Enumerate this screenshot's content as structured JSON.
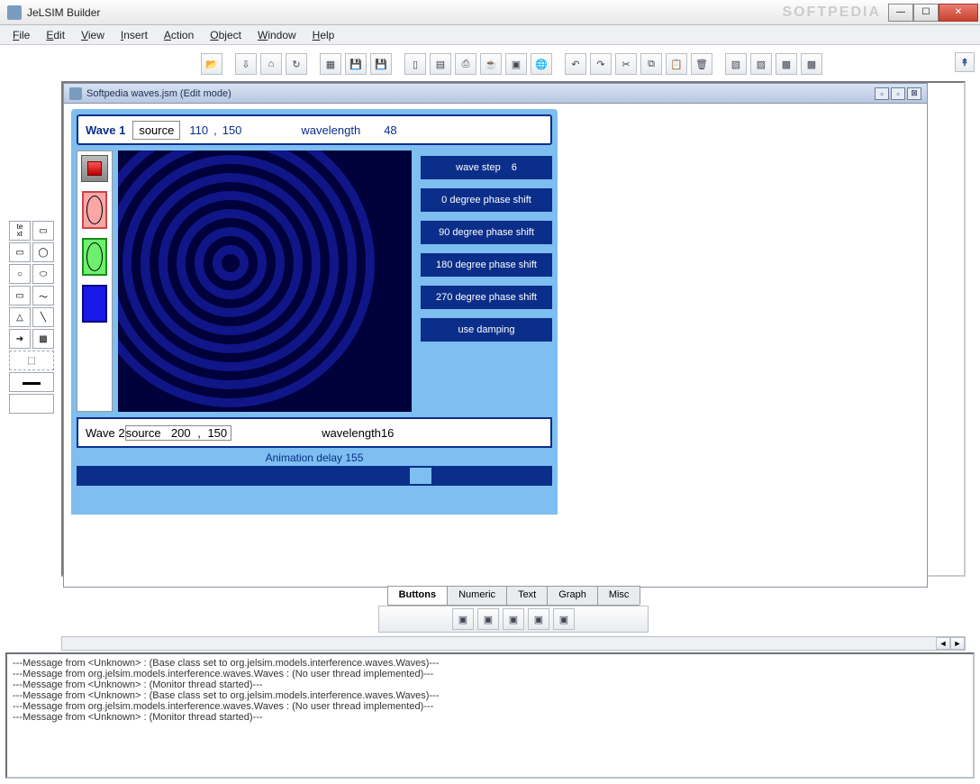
{
  "window": {
    "title": "JeLSIM Builder",
    "watermark": "SOFTPEDIA"
  },
  "menu": [
    "File",
    "Edit",
    "View",
    "Insert",
    "Action",
    "Object",
    "Window",
    "Help"
  ],
  "internal_frame": {
    "title": "Softpedia waves.jsm (Edit mode)"
  },
  "wave1": {
    "label": "Wave 1",
    "source_label": "source",
    "x": "110",
    "y": "150",
    "wl_label": "wavelength",
    "wl": "48"
  },
  "wave2": {
    "label": "Wave 2",
    "source_label": "source",
    "x": "200",
    "y": "150",
    "wl_label": "wavelength",
    "wl": "16"
  },
  "controls": {
    "wavestep_label": "wave step",
    "wavestep": "6",
    "ps0": "0 degree phase shift",
    "ps90": "90 degree phase shift",
    "ps180": "180 degree phase shift",
    "ps270": "270 degree phase shift",
    "damping": "use damping"
  },
  "slider": {
    "label": "Animation delay",
    "value": "155"
  },
  "tabs": [
    "Buttons",
    "Numeric",
    "Text",
    "Graph",
    "Misc"
  ],
  "console": [
    "---Message from <Unknown> : (Base class set to org.jelsim.models.interference.waves.Waves)---",
    "---Message from org.jelsim.models.interference.waves.Waves : (No user thread implemented)---",
    "---Message from <Unknown> : (Monitor thread started)---",
    "---Message from <Unknown> : (Base class set to org.jelsim.models.interference.waves.Waves)---",
    "---Message from org.jelsim.models.interference.waves.Waves : (No user thread implemented)---",
    "---Message from <Unknown> : (Monitor thread started)---"
  ]
}
